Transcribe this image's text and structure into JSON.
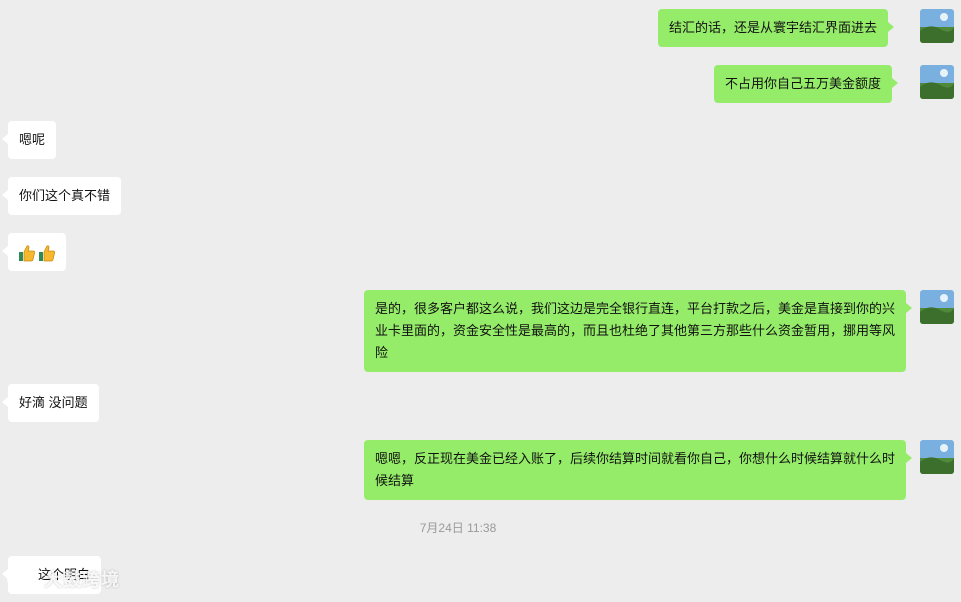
{
  "messages": [
    {
      "side": "out",
      "text": "结汇的话，还是从寰宇结汇界面进去"
    },
    {
      "side": "out",
      "text": "不占用你自己五万美金额度"
    },
    {
      "side": "in",
      "text": "嗯呢"
    },
    {
      "side": "in",
      "text": "你们这个真不错"
    },
    {
      "side": "in",
      "emoji": "thumbs-up-icon x2"
    },
    {
      "side": "out",
      "text": "是的，很多客户都这么说，我们这边是完全银行直连，平台打款之后，美金是直接到你的兴业卡里面的，资金安全性是最高的，而且也杜绝了其他第三方那些什么资金暂用，挪用等风险"
    },
    {
      "side": "in",
      "text": "好滴 没问题"
    },
    {
      "side": "out",
      "text": "嗯嗯，反正现在美金已经入账了，后续你结算时间就看你自己，你想什么时候结算就什么时候结算"
    },
    {
      "side": "in",
      "text": "这个明白"
    }
  ],
  "timestamp": "7月24日 11:38",
  "watermark": "大鼓跨境",
  "colors": {
    "background": "#ededed",
    "outgoing": "#95ec69",
    "incoming": "#ffffff",
    "timestamp": "#9a9a9a"
  }
}
